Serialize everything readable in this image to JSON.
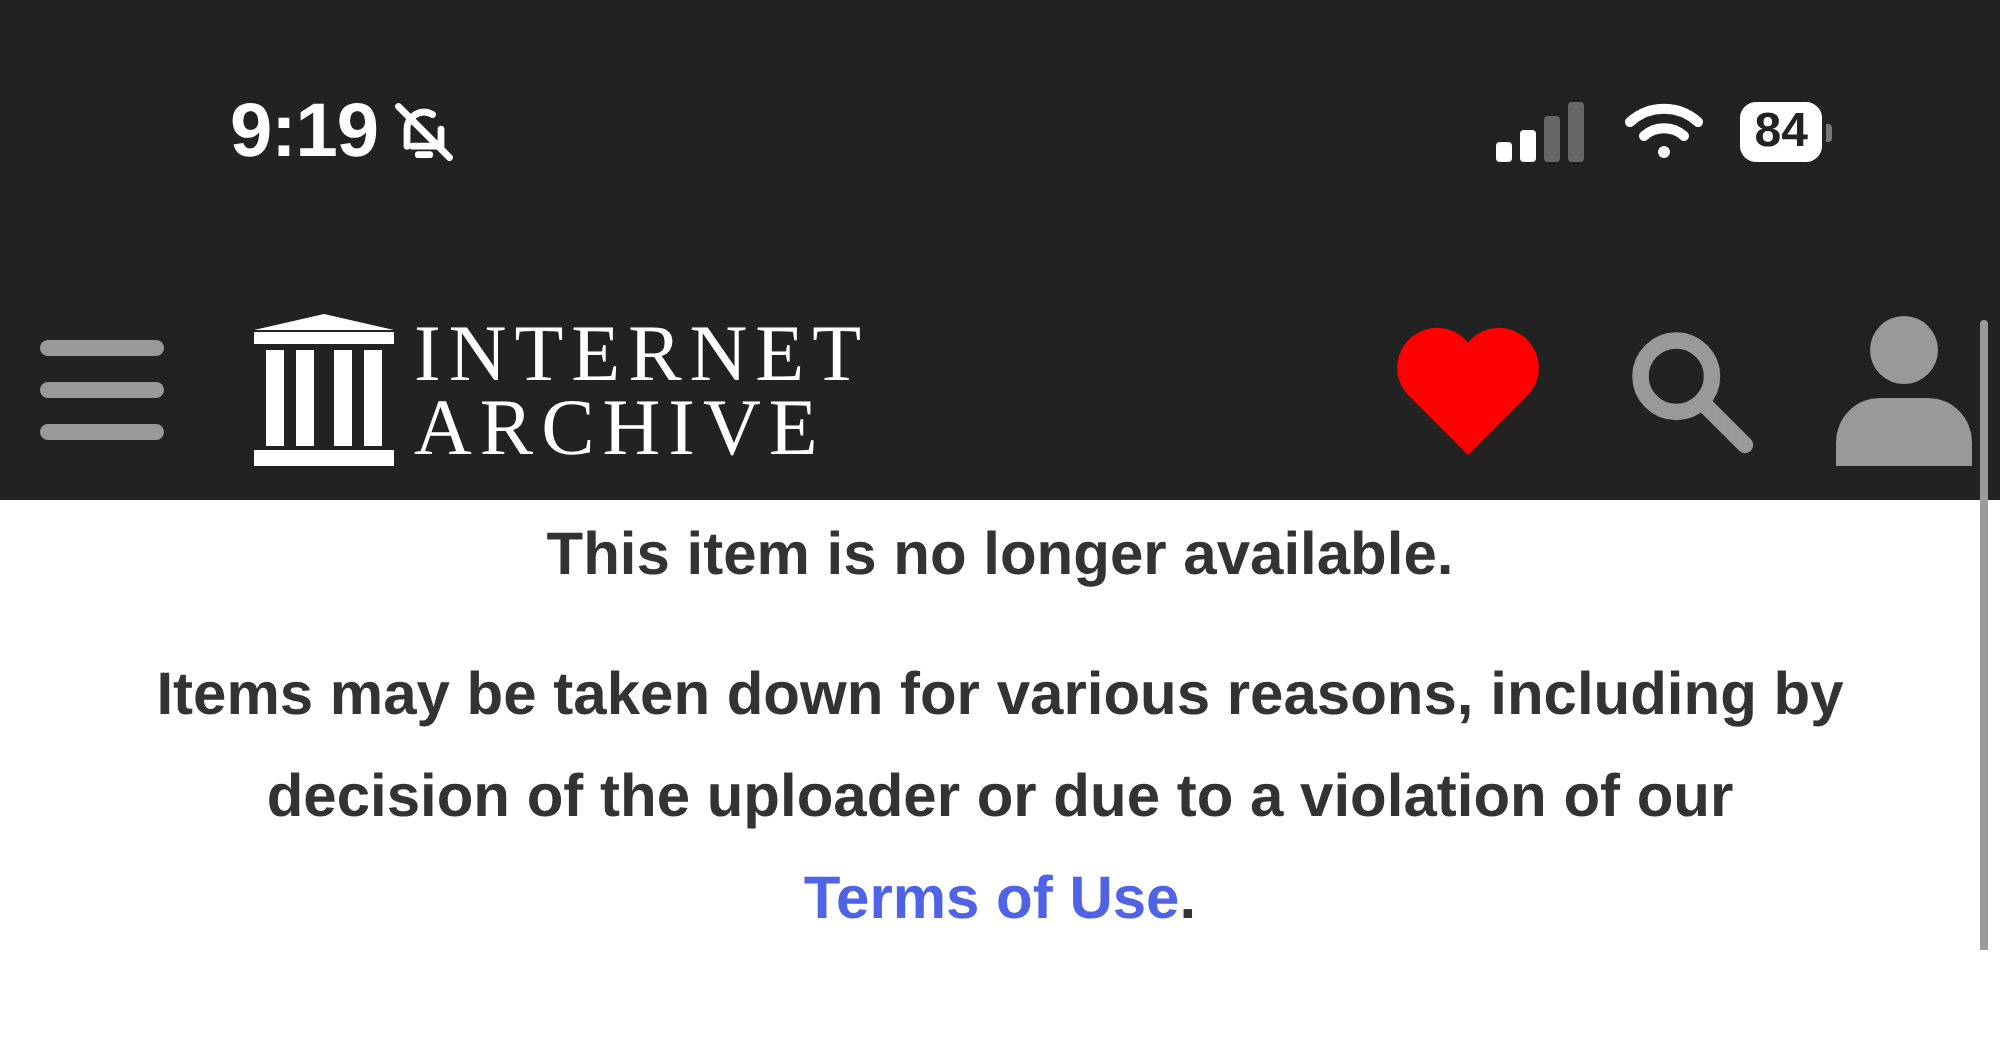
{
  "status_bar": {
    "time": "9:19",
    "battery": "84"
  },
  "header": {
    "logo_lines": [
      "INTERNET",
      "ARCHIVE"
    ]
  },
  "notice": {
    "title": "This item is no longer available.",
    "body_before": "Items may be taken down for various reasons, including by decision of the uploader or due to a violation of our ",
    "link": "Terms of Use",
    "body_after": "."
  }
}
